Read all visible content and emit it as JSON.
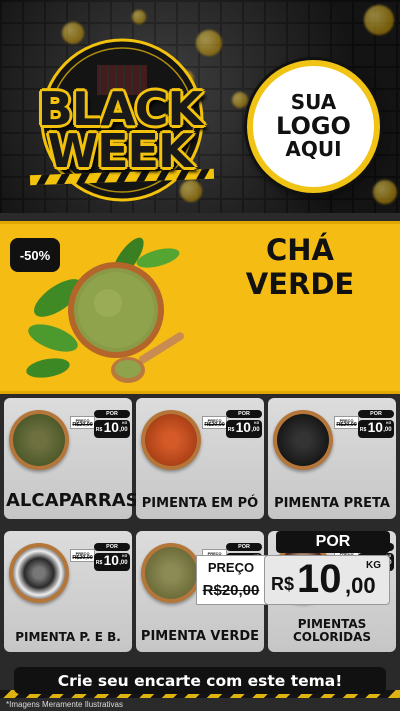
{
  "header": {
    "title_line1": "BLACK",
    "title_line2": "WEEK",
    "logo": {
      "line1": "SUA",
      "line2": "LOGO",
      "line3": "AQUI"
    }
  },
  "feature": {
    "badge": "-50%",
    "name_line1": "CHÁ",
    "name_line2": "VERDE",
    "price": {
      "preco_label": "PREÇO",
      "old_value": "R$20,00",
      "por_label": "POR",
      "currency": "R$",
      "new_int": "10",
      "new_dec": ",00",
      "unit": "KG"
    }
  },
  "products": [
    {
      "name": "ALCAPARRAS",
      "preco_label": "PREÇO",
      "old_value": "R$20,00",
      "por_label": "POR",
      "currency": "R$",
      "new_int": "10",
      "new_dec": ",00",
      "unit": "KG"
    },
    {
      "name": "PIMENTA EM PÓ",
      "preco_label": "PREÇO",
      "old_value": "R$20,00",
      "por_label": "POR",
      "currency": "R$",
      "new_int": "10",
      "new_dec": ",00",
      "unit": "KG"
    },
    {
      "name": "PIMENTA PRETA",
      "preco_label": "PREÇO",
      "old_value": "R$20,00",
      "por_label": "POR",
      "currency": "R$",
      "new_int": "10",
      "new_dec": ",00",
      "unit": "KG"
    },
    {
      "name": "PIMENTA P. E B.",
      "preco_label": "PREÇO",
      "old_value": "R$20,00",
      "por_label": "POR",
      "currency": "R$",
      "new_int": "10",
      "new_dec": ",00",
      "unit": "KG"
    },
    {
      "name": "PIMENTA VERDE",
      "preco_label": "PREÇO",
      "old_value": "R$20,00",
      "por_label": "POR",
      "currency": "R$",
      "new_int": "10",
      "new_dec": ",00",
      "unit": "KG"
    },
    {
      "name": "PIMENTAS COLORIDAS",
      "preco_label": "PREÇO",
      "old_value": "R$20,00",
      "por_label": "POR",
      "currency": "R$",
      "new_int": "10",
      "new_dec": ",00",
      "unit": "KG"
    }
  ],
  "cta": "Crie seu encarte com este tema!",
  "footnote": "*Imagens Meramente Ilustrativas",
  "colors": {
    "accent_yellow": "#f5bd13",
    "black": "#111111",
    "card_grey": "#d0d0d0"
  }
}
